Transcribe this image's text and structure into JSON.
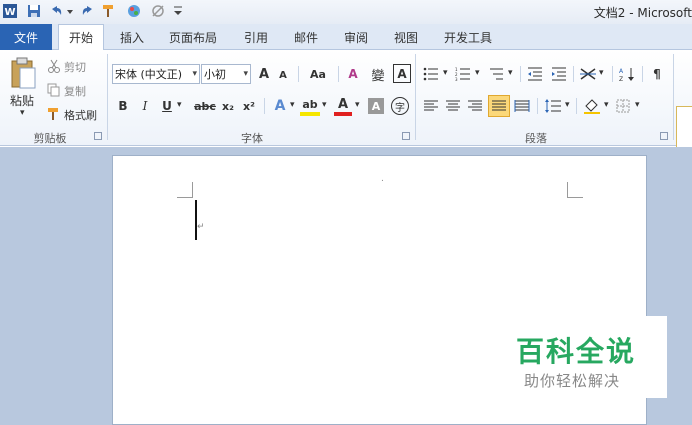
{
  "titlebar": {
    "title": "文档2 - Microsoft",
    "qa_icons": [
      "word-app-icon",
      "save-icon",
      "undo-icon",
      "redo-icon",
      "format-painter-icon",
      "color-icon",
      "clear-format-icon",
      "customize-icon"
    ]
  },
  "tabs": {
    "file": "文件",
    "items": [
      "开始",
      "插入",
      "页面布局",
      "引用",
      "邮件",
      "审阅",
      "视图",
      "开发工具"
    ],
    "active": "开始"
  },
  "clipboard": {
    "paste": "粘贴",
    "cut": "剪切",
    "copy": "复制",
    "format_painter": "格式刷",
    "label": "剪贴板"
  },
  "font": {
    "font_name": "宋体 (中文正)",
    "font_size": "小初",
    "grow": "A",
    "shrink": "A",
    "change_case": "Aa",
    "clear": "A",
    "phonetic": "變",
    "border": "A",
    "bold": "B",
    "italic": "I",
    "underline": "U",
    "strike": "abc",
    "subscript": "x₂",
    "superscript": "x²",
    "effects": "A",
    "highlight": "ab",
    "font_color": "A",
    "shading": "A",
    "enclose": "字",
    "label": "字体"
  },
  "paragraph": {
    "label": "段落"
  },
  "watermark": {
    "title": "百科全说",
    "subtitle": "助你轻松解决"
  },
  "colors": {
    "file_tab": "#2a64b4",
    "watermark_green": "#27a860",
    "workspace": "#b8c8de"
  }
}
